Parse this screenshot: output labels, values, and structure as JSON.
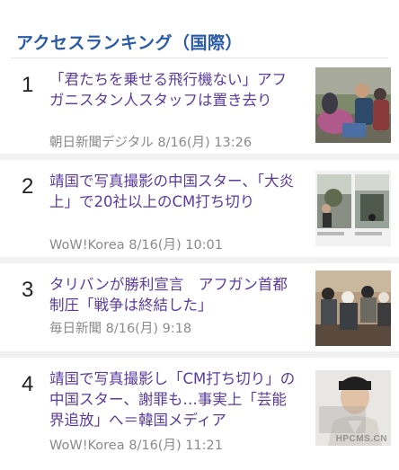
{
  "section": {
    "title": "アクセスランキング（国際）"
  },
  "ranking": [
    {
      "rank": "1",
      "headline": "「君たちを乗せる飛行機ない」アフガニスタン人スタッフは置き去り",
      "source": "朝日新聞デジタル",
      "date": "8/16(月) 13:26",
      "thumb_icon": "refugee-photo"
    },
    {
      "rank": "2",
      "headline": "靖国で写真撮影の中国スター、「大炎上」で20社以上のCM打ち切り",
      "source": "WoW!Korea",
      "date": "8/16(月) 10:01",
      "thumb_icon": "social-post-photo"
    },
    {
      "rank": "3",
      "headline": "タリバンが勝利宣言　アフガン首都制圧「戦争は終結した」",
      "source": "毎日新聞",
      "date": "8/16(月) 9:18",
      "thumb_icon": "taliban-group-photo"
    },
    {
      "rank": "4",
      "headline": "靖国で写真撮影し「CM打ち切り」の中国スター、謝罪も…事実上「芸能界追放」へ＝韓国メディア",
      "source": "WoW!Korea",
      "date": "8/16(月) 11:21",
      "thumb_icon": "actor-portrait-photo"
    }
  ],
  "watermark": {
    "text": "HPCMS.CN"
  },
  "colors": {
    "title": "#2a5aa6",
    "headline_visited": "#5a3b9c",
    "meta": "#8a8a8a",
    "separator": "#f1f1f1"
  }
}
